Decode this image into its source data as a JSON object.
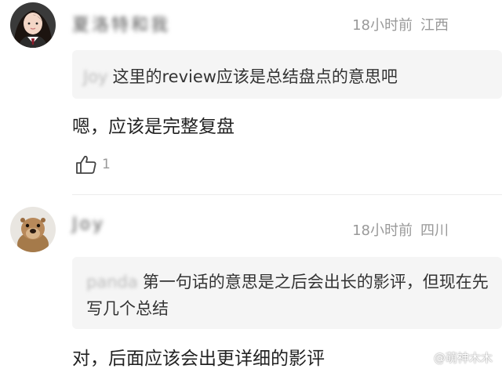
{
  "comments": [
    {
      "username": "夏洛特和我",
      "time": "18小时前",
      "location": "江西",
      "quote_author": "Joy",
      "quote_text": "这里的review应该是总结盘点的意思吧",
      "reply": "嗯，应该是完整复盘",
      "likes": "1"
    },
    {
      "username": "Joy",
      "time": "18小时前",
      "location": "四川",
      "quote_author": "panda",
      "quote_text": "第一句话的意思是之后会出长的影评，但现在先写几个总结",
      "reply": "对，后面应该会出更详细的影评"
    }
  ],
  "watermark": "@萌神木木",
  "icons": {
    "like": "thumbs-up-icon"
  },
  "colors": {
    "meta": "#999999",
    "quote_bg": "#f5f5f5",
    "text": "#222222"
  }
}
